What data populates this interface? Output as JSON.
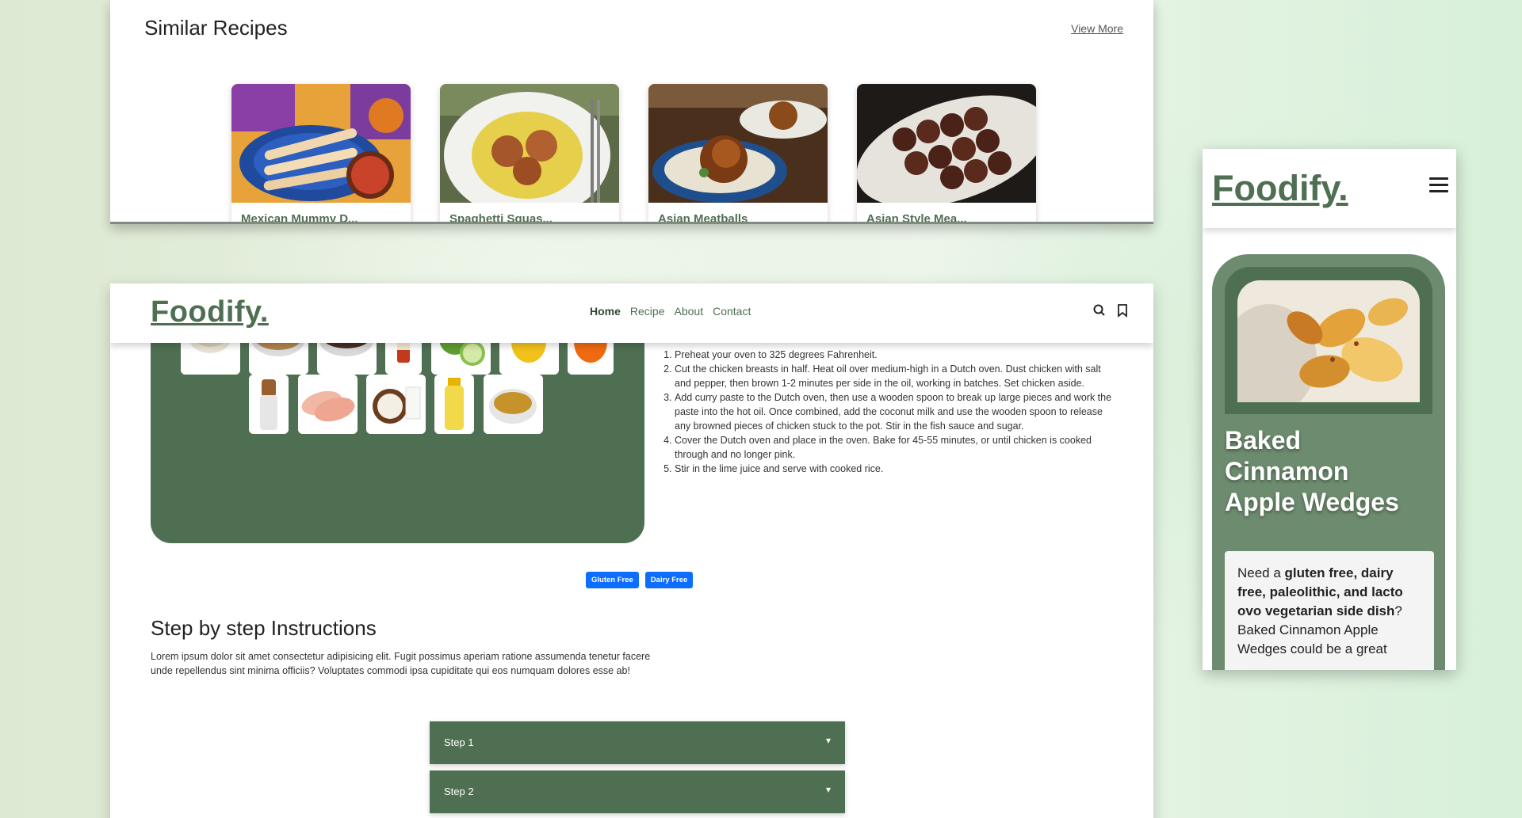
{
  "similar": {
    "title": "Similar Recipes",
    "view_more": "View More",
    "cards": [
      {
        "label": "Mexican Mummy D..."
      },
      {
        "label": "Spaghetti Squas..."
      },
      {
        "label": "Asian Meatballs"
      },
      {
        "label": "Asian Style Mea..."
      }
    ]
  },
  "nav": {
    "logo": "Foodify.",
    "links": {
      "home": "Home",
      "recipe": "Recipe",
      "about": "About",
      "contact": "Contact"
    },
    "search_icon": "search-icon",
    "bookmark_icon": "bookmark-icon"
  },
  "ingredients": {
    "icons": [
      "rice",
      "brown-sugar",
      "bean",
      "sauce-bottle",
      "lime",
      "yellow-pepper",
      "orange-pepper",
      "pepper-grinder",
      "chicken-breast",
      "coconut-milk",
      "oil-bottle",
      "curry-paste"
    ]
  },
  "method": {
    "steps": [
      "Preheat your oven to 325 degrees Fahrenheit.",
      "Cut the chicken breasts in half. Heat oil over medium-high in a Dutch oven. Dust chicken with salt and pepper, then brown 1-2 minutes per side in the oil, working in batches. Set chicken aside.",
      "Add curry paste to the Dutch oven, then use a wooden spoon to break up large pieces and work the paste into the hot oil. Once combined, add the coconut milk and use the wooden spoon to release any browned pieces of chicken stuck to the pot. Stir in the fish sauce and sugar.",
      "Cover the Dutch oven and place in the oven. Bake for 45-55 minutes, or until chicken is cooked through and no longer pink.",
      "Stir in the lime juice and serve with cooked rice."
    ]
  },
  "tags": {
    "gluten": "Gluten Free",
    "dairy": "Dairy Free"
  },
  "instructions": {
    "title": "Step by step Instructions",
    "body": "Lorem ipsum dolor sit amet consectetur adipisicing elit. Fugit possimus aperiam ratione assumenda tenetur facere unde repellendus sint minima officiis? Voluptates commodi ipsa cupiditate qui eos numquam dolores esse ab!",
    "step1": "Step 1",
    "step2": "Step 2"
  },
  "mobile": {
    "logo": "Foodify.",
    "hero_title": "Baked Cinnamon Apple Wedges",
    "desc_prefix": "Need a ",
    "desc_bold": "gluten free, dairy free, paleolithic, and lacto ovo vegetarian side dish",
    "desc_suffix": "? Baked Cinnamon Apple Wedges could be a great",
    "menu_icon": "hamburger-menu-icon"
  },
  "colors": {
    "brand_green": "#4f6f52",
    "tag_blue": "#0d6efd"
  }
}
